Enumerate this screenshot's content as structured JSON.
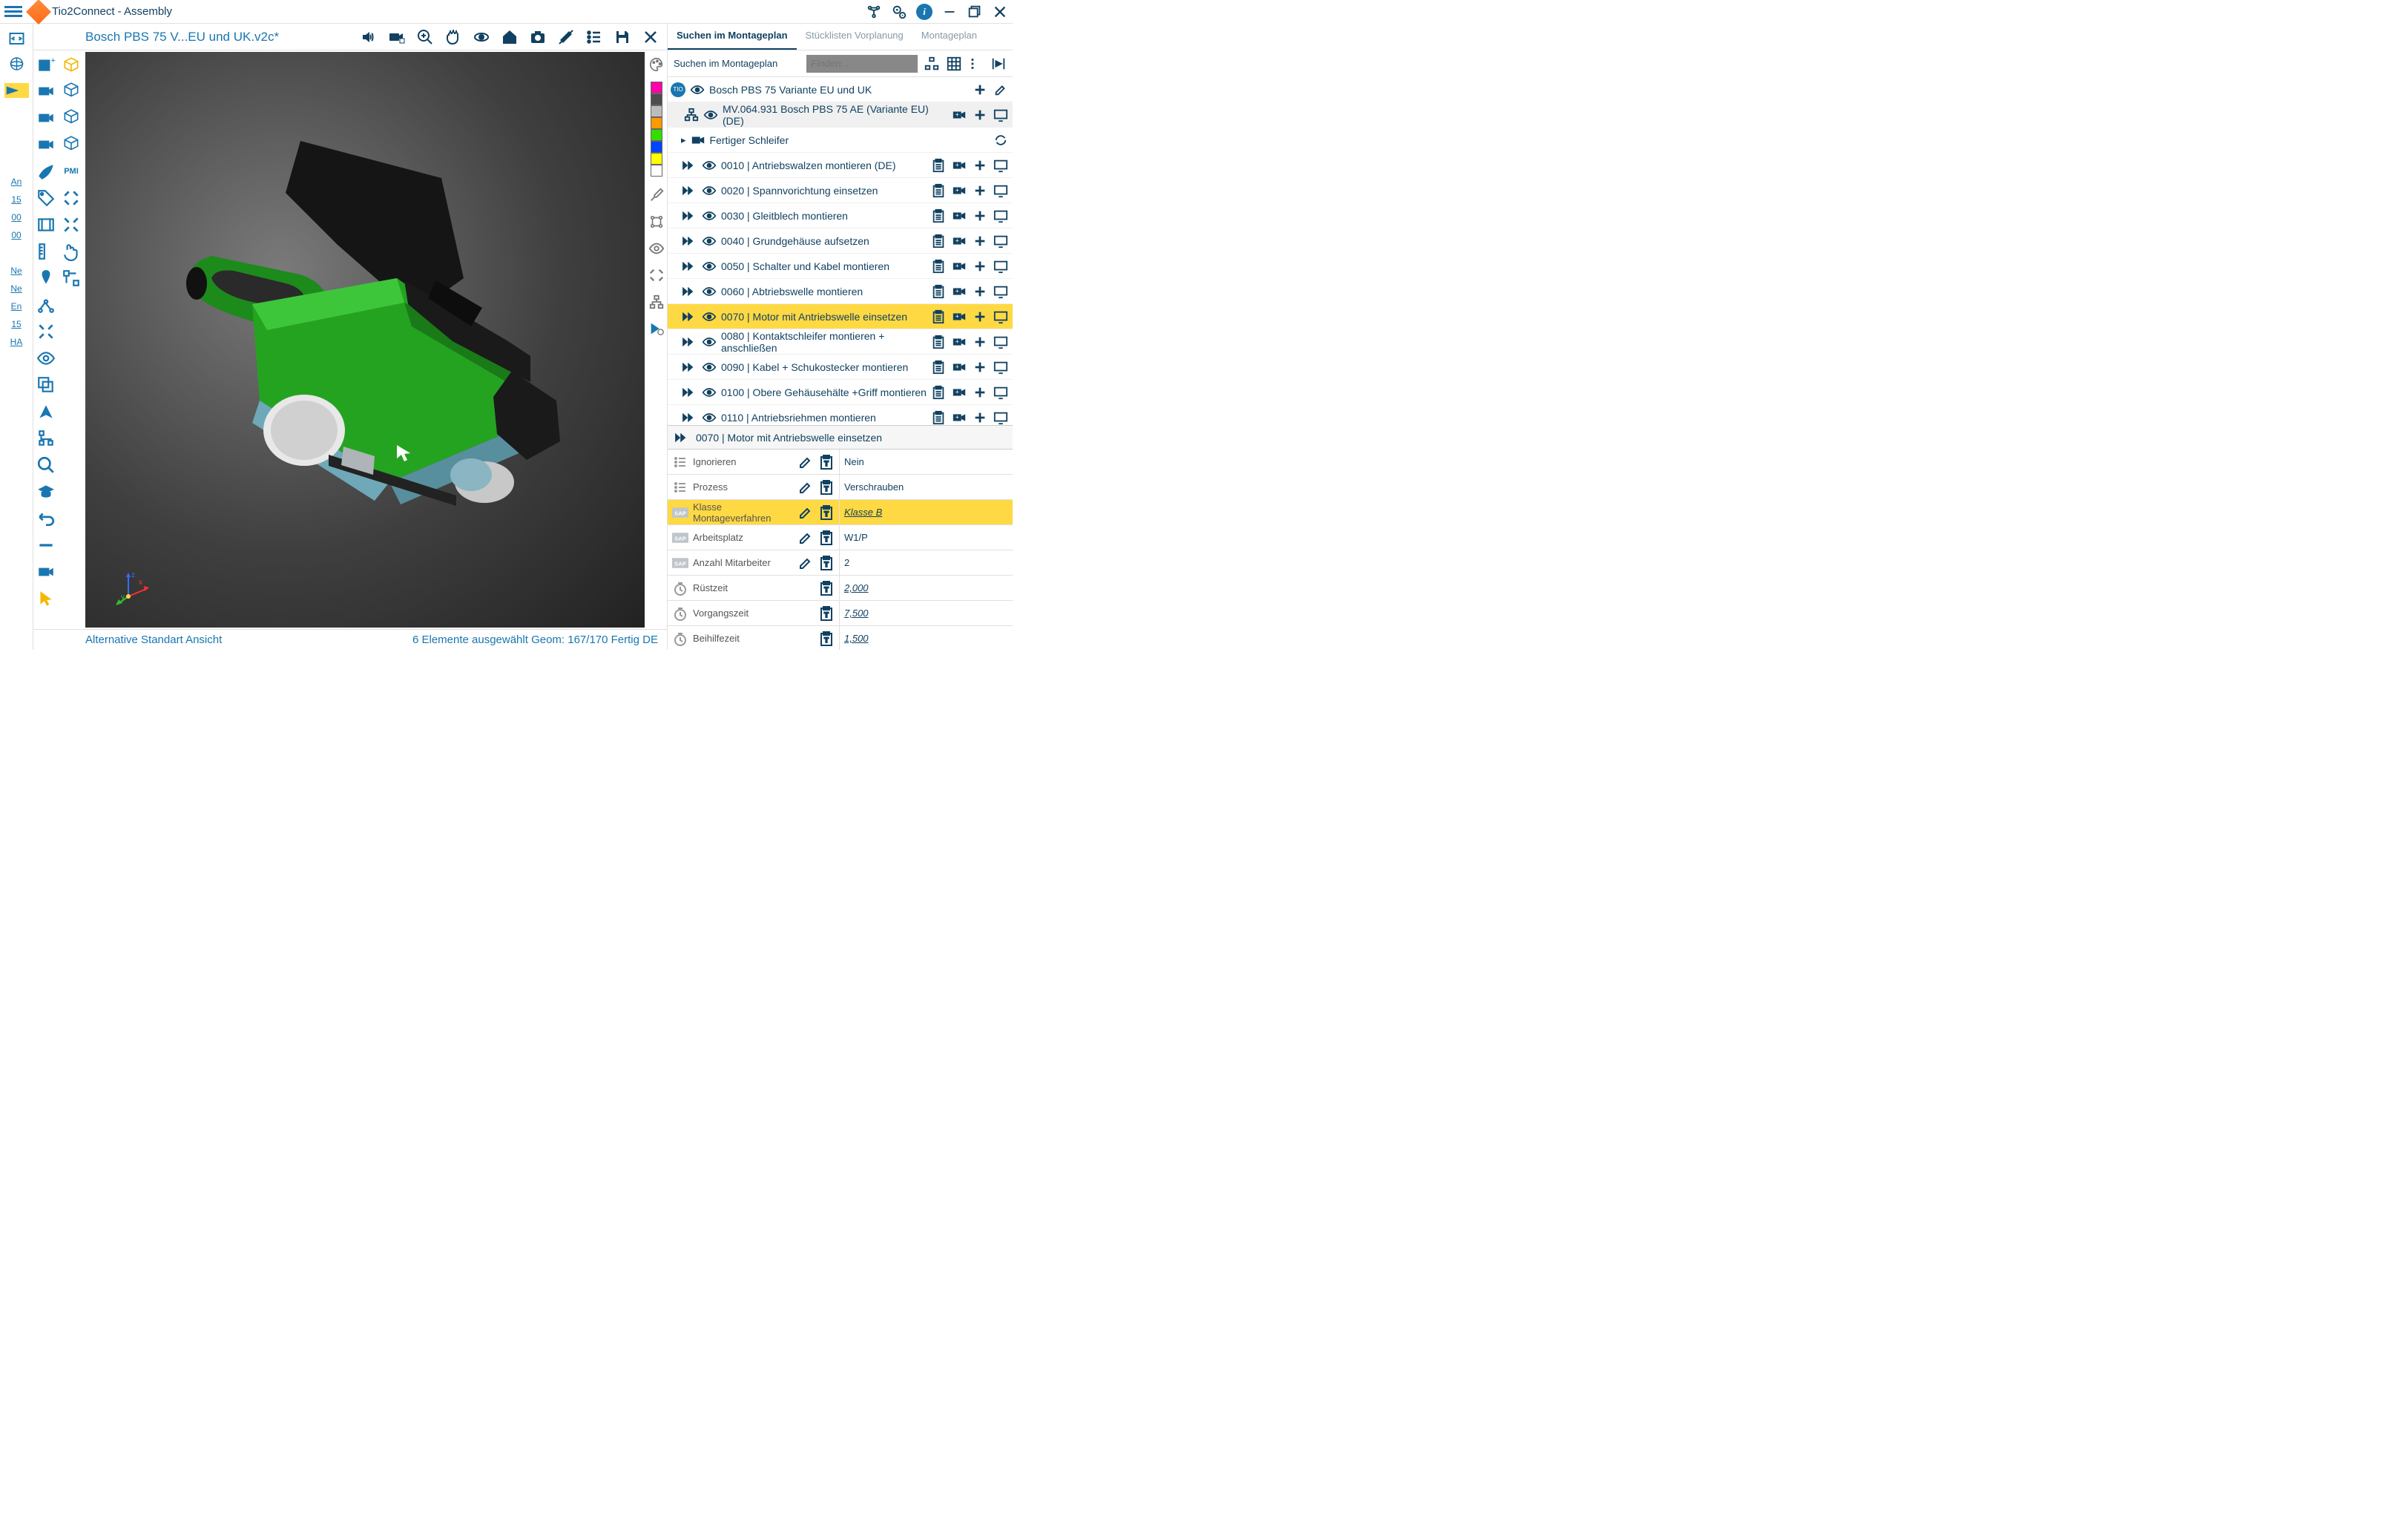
{
  "app_title": "Tio2Connect - Assembly",
  "doc_title": "Bosch PBS 75 V...EU und UK.v2c*",
  "status_left": "Alternative Standart Ansicht",
  "status_right": "6 Elemente ausgewählt Geom: 167/170 Fertig DE",
  "pmi_label": "PMI",
  "left_items": [
    "",
    "",
    "",
    "",
    "An",
    "15",
    "00",
    "00",
    "",
    "Ne",
    "Ne",
    "En",
    "15",
    "HA"
  ],
  "right_tabs": [
    "Suchen im Montageplan",
    "Stücklisten Vorplanung",
    "Montageplan"
  ],
  "search_label": "Suchen im Montageplan",
  "search_placeholder": "Finden...",
  "swatches": [
    "#ff00aa",
    "#4d4d4d",
    "#bcbcbc",
    "#ff9900",
    "#33dd00",
    "#0044ff",
    "#ffff00",
    "#ffffff"
  ],
  "tree": [
    {
      "indent": 0,
      "txt": "Bosch PBS 75 Variante EU und UK",
      "type": "root"
    },
    {
      "indent": 1,
      "txt": "MV.064.931 Bosch PBS 75 AE (Variante EU) (DE)",
      "type": "asm",
      "grey": true
    },
    {
      "indent": 1,
      "txt": "Fertiger Schleifer",
      "type": "cam"
    },
    {
      "indent": 1,
      "txt": "0010 | Antriebswalzen montieren (DE)",
      "type": "op"
    },
    {
      "indent": 1,
      "txt": "0020 | Spannvorichtung einsetzen",
      "type": "op"
    },
    {
      "indent": 1,
      "txt": "0030 | Gleitblech montieren",
      "type": "op"
    },
    {
      "indent": 1,
      "txt": "0040 | Grundgehäuse aufsetzen",
      "type": "op"
    },
    {
      "indent": 1,
      "txt": "0050 | Schalter und Kabel montieren",
      "type": "op"
    },
    {
      "indent": 1,
      "txt": "0060 | Abtriebswelle montieren",
      "type": "op"
    },
    {
      "indent": 1,
      "txt": "0070 | Motor mit Antriebswelle einsetzen",
      "type": "op",
      "sel": true
    },
    {
      "indent": 1,
      "txt": "0080 | Kontaktschleifer montieren + anschließen",
      "type": "op"
    },
    {
      "indent": 1,
      "txt": "0090 | Kabel + Schukostecker montieren",
      "type": "op"
    },
    {
      "indent": 1,
      "txt": "0100 | Obere Gehäusehälte +Griff montieren",
      "type": "op"
    },
    {
      "indent": 1,
      "txt": "0110 | Antriebsriehmen montieren",
      "type": "op"
    }
  ],
  "detail_title": "0070 | Motor mit Antriebswelle einsetzen",
  "props": [
    {
      "icon": "list",
      "label": "Ignorieren",
      "value": "Nein",
      "edit": true,
      "paste": true
    },
    {
      "icon": "list",
      "label": "Prozess",
      "value": "Verschrauben",
      "edit": true,
      "paste": true
    },
    {
      "icon": "sap",
      "label": "Klasse Montageverfahren",
      "value": "Klasse B",
      "edit": true,
      "paste": true,
      "sel": true,
      "u": true
    },
    {
      "icon": "sap",
      "label": "Arbeitsplatz",
      "value": "W1/P",
      "edit": true,
      "paste": true
    },
    {
      "icon": "sap",
      "label": "Anzahl Mitarbeiter",
      "value": "2",
      "edit": true,
      "paste": true
    },
    {
      "icon": "clock",
      "label": "Rüstzeit",
      "value": "2,000",
      "paste": true,
      "u": true
    },
    {
      "icon": "clock",
      "label": "Vorgangszeit",
      "value": "7,500",
      "paste": true,
      "u": true
    },
    {
      "icon": "clock",
      "label": "Beihilfezeit",
      "value": "1,500",
      "paste": true,
      "u": true
    }
  ]
}
